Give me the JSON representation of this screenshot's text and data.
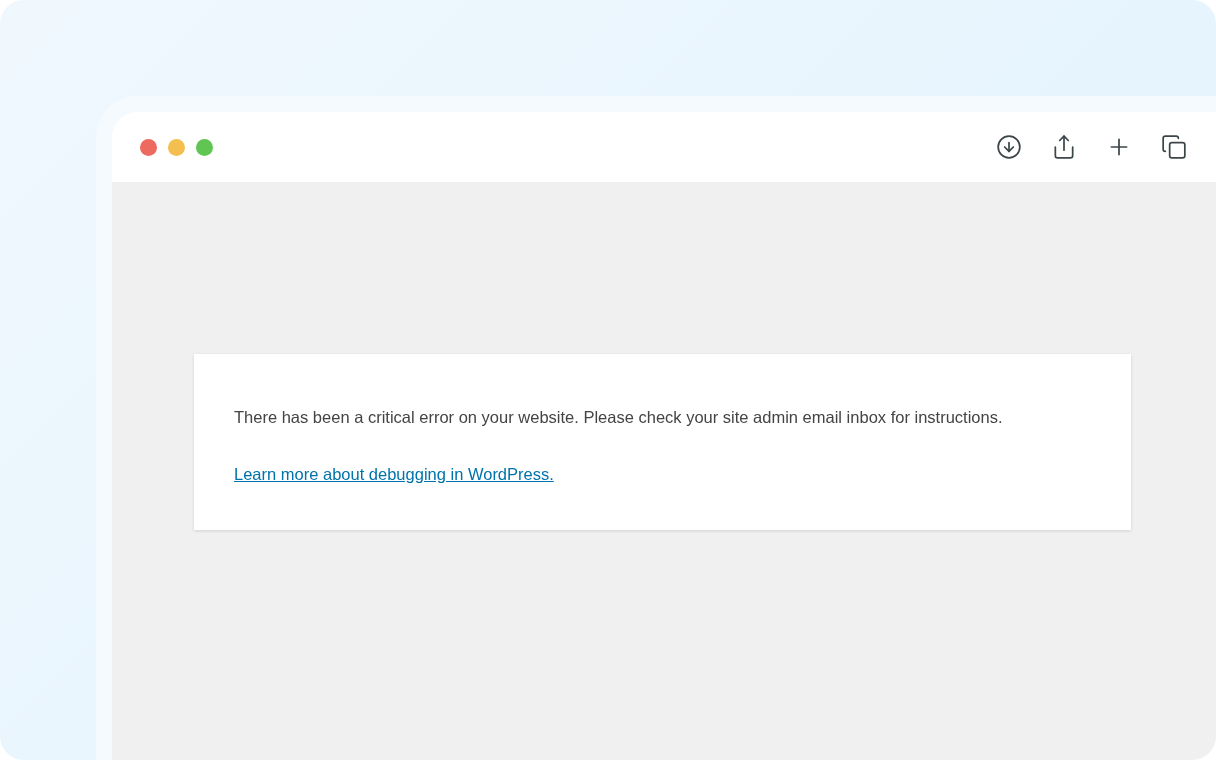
{
  "window_controls": [
    {
      "color": "#ec6a5e"
    },
    {
      "color": "#f4bf4f"
    },
    {
      "color": "#61c554"
    }
  ],
  "toolbar": {
    "buttons": [
      {
        "kind": "download"
      },
      {
        "kind": "share"
      },
      {
        "kind": "new-tab"
      },
      {
        "kind": "tabs"
      }
    ]
  },
  "error_card": {
    "message": "There has been a critical error on your website. Please check your site admin email inbox for instructions.",
    "link": "Learn more about debugging in WordPress."
  }
}
